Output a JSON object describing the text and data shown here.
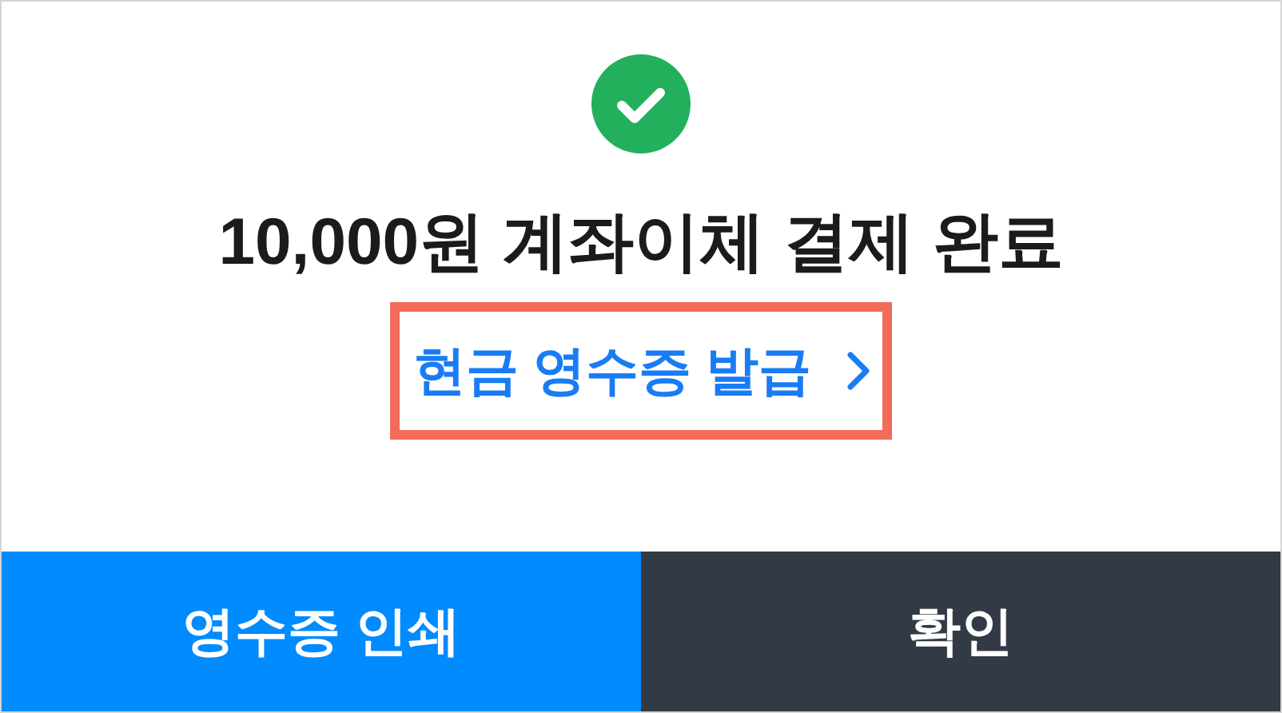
{
  "status": {
    "kind": "success"
  },
  "title": "10,000원 계좌이체 결제 완료",
  "link": {
    "label": "현금 영수증 발급",
    "highlighted": true
  },
  "buttons": [
    {
      "label": "영수증 인쇄",
      "kind": "secondary"
    },
    {
      "label": "확인",
      "kind": "primary"
    }
  ]
}
